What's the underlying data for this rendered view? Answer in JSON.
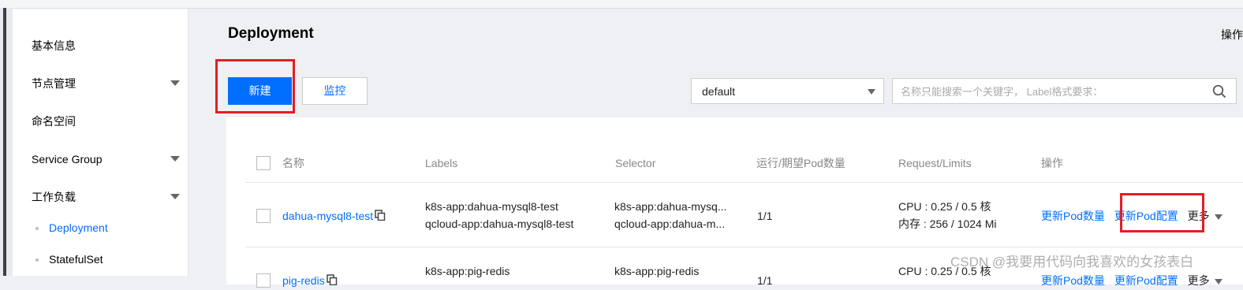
{
  "sidebar": {
    "items": [
      {
        "label": "基本信息",
        "has_caret": false
      },
      {
        "label": "节点管理",
        "has_caret": true
      },
      {
        "label": "命名空间",
        "has_caret": false
      },
      {
        "label": "Service Group",
        "has_caret": true
      },
      {
        "label": "工作负载",
        "has_caret": true
      }
    ],
    "subitems": [
      {
        "label": "Deployment",
        "active": true
      },
      {
        "label": "StatefulSet",
        "active": false
      }
    ]
  },
  "header": {
    "title": "Deployment",
    "ops_label": "操作"
  },
  "toolbar": {
    "new_label": "新建",
    "monitor_label": "监控",
    "namespace_value": "default",
    "search_placeholder": "名称只能搜索一个关键字， Label格式要求："
  },
  "table": {
    "columns": [
      "名称",
      "Labels",
      "Selector",
      "运行/期望Pod数量",
      "Request/Limits",
      "操作"
    ],
    "rows": [
      {
        "name": "dahua-mysql8-test",
        "labels": [
          "k8s-app:dahua-mysql8-test",
          "qcloud-app:dahua-mysql8-test"
        ],
        "selector": [
          "k8s-app:dahua-mysq...",
          "qcloud-app:dahua-m..."
        ],
        "pods": "1/1",
        "resources": [
          "CPU : 0.25 / 0.5 核",
          "内存 : 256 / 1024 Mi"
        ],
        "actions": [
          "更新Pod数量",
          "更新Pod配置",
          "更多"
        ]
      },
      {
        "name": "pig-redis",
        "labels": [
          "k8s-app:pig-redis"
        ],
        "selector": [
          "k8s-app:pig-redis"
        ],
        "pods": "1/1",
        "resources": [
          "CPU : 0.25 / 0.5 核"
        ],
        "actions": [
          "更新Pod数量",
          "更新Pod配置",
          "更多"
        ]
      }
    ]
  },
  "watermark": "CSDN @我要用代码向我喜欢的女孩表白",
  "colors": {
    "primary": "#006eff",
    "highlight_box": "#e51d24"
  }
}
